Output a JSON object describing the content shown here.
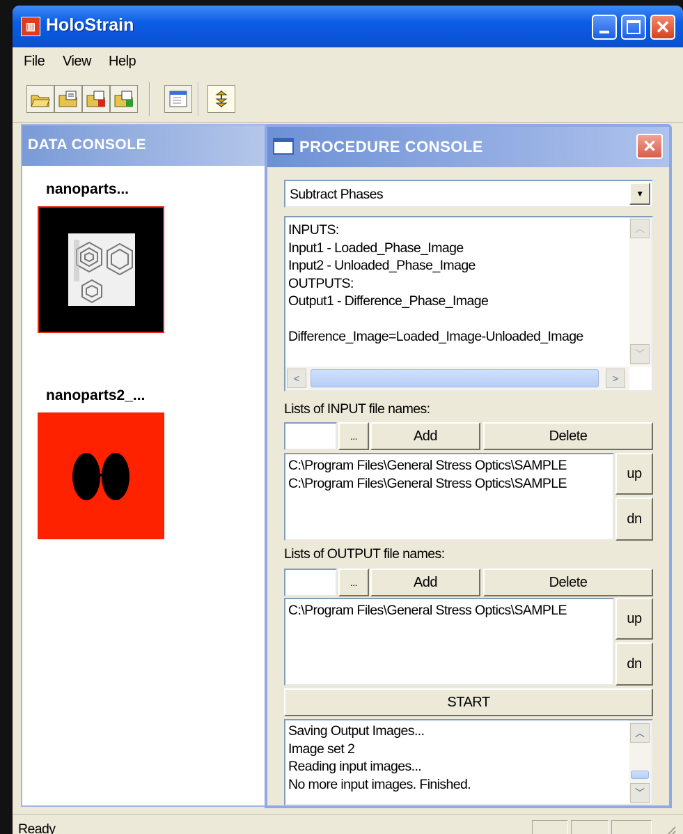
{
  "window": {
    "title": "HoloStrain",
    "app_icon_glyph": "▥"
  },
  "menu": {
    "file": "File",
    "view": "View",
    "help": "Help"
  },
  "toolbar_icons": [
    "open-folder-icon",
    "save-folder-icon",
    "delete-folder-icon",
    "add-folder-icon",
    "window-icon",
    "procedure-icon"
  ],
  "data_console": {
    "title": "DATA CONSOLE",
    "items": [
      {
        "label": "nanoparts...",
        "bg": "#000000"
      },
      {
        "label": "nanoparts2_...",
        "bg": "#ff2200"
      }
    ]
  },
  "procedure_console": {
    "title": "PROCEDURE CONSOLE",
    "procedure_select": "Subtract Phases",
    "description_lines": [
      "INPUTS:",
      "Input1 - Loaded_Phase_Image",
      "Input2 - Unloaded_Phase_Image",
      "OUTPUTS:",
      "Output1 - Difference_Phase_Image",
      "",
      "Difference_Image=Loaded_Image-Unloaded_Image"
    ],
    "input_section": {
      "label": "Lists of INPUT file names:",
      "browse": "...",
      "add": "Add",
      "delete": "Delete",
      "files": [
        "C:\\Program Files\\General Stress Optics\\SAMPLE",
        "C:\\Program Files\\General Stress Optics\\SAMPLE"
      ],
      "up": "up",
      "dn": "dn"
    },
    "output_section": {
      "label": "Lists of OUTPUT file names:",
      "browse": "...",
      "add": "Add",
      "delete": "Delete",
      "files": [
        "C:\\Program Files\\General Stress Optics\\SAMPLE"
      ],
      "up": "up",
      "dn": "dn"
    },
    "start": "START",
    "log_lines": [
      "Saving Output Images...",
      "Image set 2",
      "Reading input images...",
      "No more input images. Finished."
    ]
  },
  "status": {
    "text": "Ready"
  }
}
